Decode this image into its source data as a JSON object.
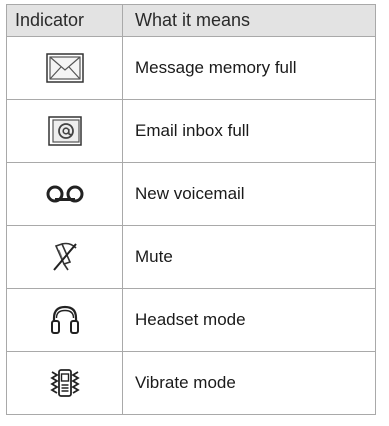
{
  "table": {
    "headers": [
      "Indicator",
      "What it means"
    ],
    "rows": [
      {
        "icon": "message-memory-full-icon",
        "label": "Message memory full"
      },
      {
        "icon": "email-inbox-full-icon",
        "label": "Email inbox full"
      },
      {
        "icon": "voicemail-icon",
        "label": "New voicemail"
      },
      {
        "icon": "mute-icon",
        "label": "Mute"
      },
      {
        "icon": "headset-icon",
        "label": "Headset mode"
      },
      {
        "icon": "vibrate-icon",
        "label": "Vibrate mode"
      }
    ]
  }
}
